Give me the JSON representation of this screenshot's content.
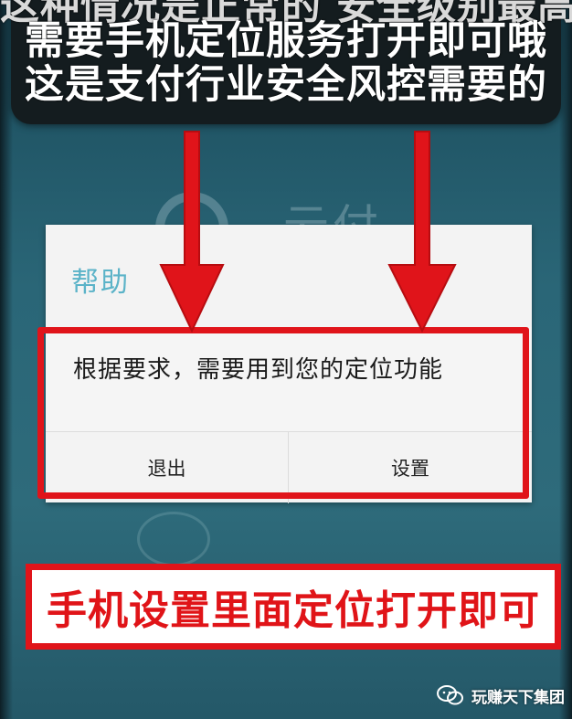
{
  "top_banner": {
    "lines": [
      "这种情况是正常的 安全级别最高",
      "需要手机定位服务打开即可哦",
      "这是支付行业安全风控需要的"
    ]
  },
  "background_app": {
    "logo_text": "云付"
  },
  "dialog": {
    "title": "帮助",
    "message": "根据要求，需要用到您的定位功能",
    "buttons": {
      "exit_label": "退出",
      "settings_label": "设置"
    }
  },
  "bottom_caption": {
    "text": "手机设置里面定位打开即可"
  },
  "watermark": {
    "text": "玩赚天下集团",
    "icon": "wechat-icon"
  },
  "colors": {
    "highlight_red": "#e0141a",
    "title_teal": "#5bb3c8",
    "banner_bg": "#141c1f",
    "background_teal": "#2a6677"
  }
}
